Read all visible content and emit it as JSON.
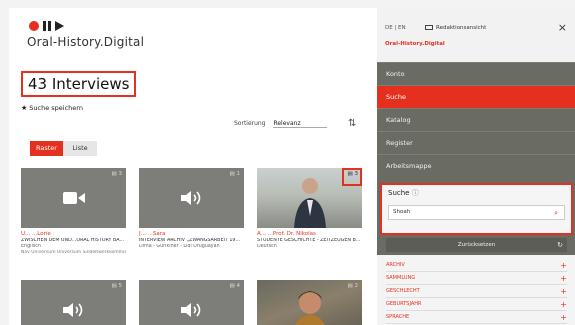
{
  "brand": {
    "name": "Oral-History.Digital"
  },
  "results": {
    "title": "43 Interviews",
    "save_search": "Suche speichern",
    "sort_label": "Sortierung",
    "sort_value": "Relevanz",
    "view_raster": "Raster",
    "view_liste": "Liste"
  },
  "cards": [
    {
      "count": "3",
      "media": "video",
      "cap1": "U... ...Lorie",
      "cap2": "ZWISCHEN DEM UND...ORAL HISTORY BA...",
      "cap3": "Englisch",
      "cap4": "Nav Universum Universum Sindeltwerkkommisser"
    },
    {
      "count": "1",
      "media": "audio",
      "cap1": "J... ...Sara",
      "cap2": "INTERVIEW ARCHIV „ZWANGSARBEIT 19...",
      "cap3": "Dima - Gürlkiner - Lidl Uruguayan",
      "cap4": ""
    },
    {
      "count": "3",
      "media": "photo",
      "cap1": "A... ...Prof. Dr. Nikolas",
      "cap2": "STUDENTE GESCHICHTE - ZEITZEUGEN B...",
      "cap3": "Deutsch",
      "cap4": ""
    },
    {
      "count": "5",
      "media": "audio",
      "cap1": "",
      "cap2": "",
      "cap3": "",
      "cap4": ""
    },
    {
      "count": "4",
      "media": "audio",
      "cap1": "",
      "cap2": "",
      "cap3": "",
      "cap4": ""
    },
    {
      "count": "2",
      "media": "photo2",
      "cap1": "",
      "cap2": "",
      "cap3": "",
      "cap4": ""
    }
  ],
  "sidebar": {
    "lang": "DE | EN",
    "redaktion": "Redaktionsansicht",
    "brand_small": "Oral-History.Digital",
    "nav": [
      "Konto",
      "Suche",
      "Katalog",
      "Register",
      "Arbeitsmappe"
    ],
    "active_nav": "Suche",
    "suche_label": "Suche",
    "suche_value": "Shoah",
    "reset": "Zurücksetzen",
    "facets": [
      "ARCHIV",
      "SAMMLUNG",
      "GESCHLECHT",
      "GEBURTSJAHR",
      "SPRACHE"
    ]
  },
  "colors": {
    "accent": "#e53020",
    "sidebar": "#6a6b63"
  }
}
